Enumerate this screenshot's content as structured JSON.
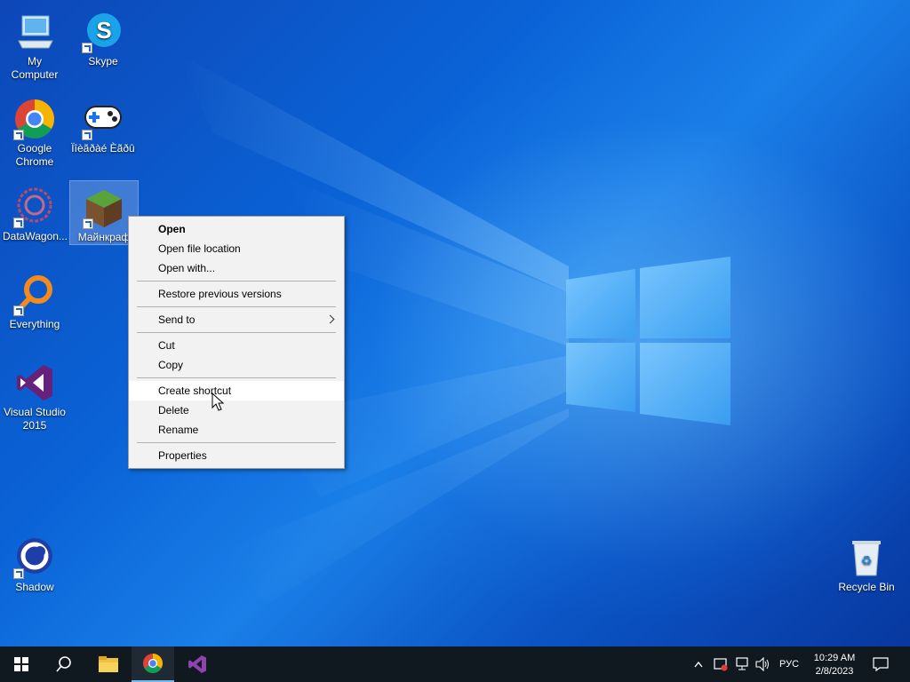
{
  "desktop": {
    "icons": [
      {
        "id": "my-computer",
        "label": "My Computer"
      },
      {
        "id": "skype",
        "label": "Skype"
      },
      {
        "id": "google-chrome",
        "label": "Google Chrome"
      },
      {
        "id": "game-shortcut",
        "label": "Ïîèãðàé Èãðû"
      },
      {
        "id": "datawagon",
        "label": "DataWagon..."
      },
      {
        "id": "minecraft",
        "label": "Майнкраф"
      },
      {
        "id": "everything",
        "label": "Everything"
      },
      {
        "id": "visual-studio",
        "label": "Visual Studio 2015"
      },
      {
        "id": "shadow",
        "label": "Shadow"
      },
      {
        "id": "recycle-bin",
        "label": "Recycle Bin"
      }
    ]
  },
  "context_menu": {
    "items": [
      "Open",
      "Open file location",
      "Open with...",
      "Restore previous versions",
      "Send to",
      "Cut",
      "Copy",
      "Create shortcut",
      "Delete",
      "Rename",
      "Properties"
    ],
    "hovered": "Create shortcut"
  },
  "taskbar": {
    "language": "РУС",
    "time": "10:29 AM",
    "date": "2/8/2023"
  },
  "colors": {
    "taskbar": "#101820",
    "menu_bg": "#f2f2f2",
    "desktop_blue": "#0a63d6"
  }
}
